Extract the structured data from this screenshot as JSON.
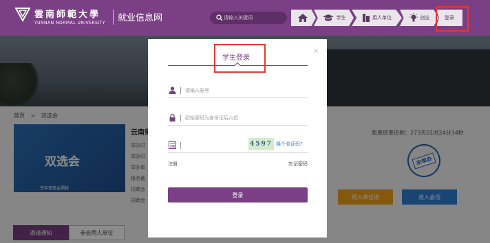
{
  "header": {
    "logo_cn": "雲南師範大學",
    "logo_en": "YUNNAN NORMAL UNIVERSITY",
    "site_title": "就业信息网",
    "search_placeholder": "请输入关键词"
  },
  "nav": {
    "student": "学生",
    "company": "用人单位",
    "startup": "创业",
    "login": "登录"
  },
  "page": {
    "breadcrumb": [
      "首页",
      ">",
      "双选会"
    ],
    "thumb_title": "双选会",
    "thumb_sub": "空中双选会揭秘",
    "event_title": "云南师",
    "event_rows": [
      "举办时",
      "举办时",
      "举办单",
      "报名截",
      "招聘会",
      "招聘会"
    ],
    "countdown": "距离结束还剩：273天01时24分34秒",
    "stamp": "未举办",
    "btn_company": "用人单位进",
    "btn_enter": "进入会场",
    "tabs": [
      "邀请通知",
      "参会用人单位"
    ]
  },
  "modal": {
    "title": "学生登录",
    "close": "×",
    "account_placeholder": "请输入账号",
    "password_placeholder": "初始密码为身份证后六位",
    "code_value": "",
    "captcha": "4597",
    "refresh_code": "换个验证码?",
    "register": "注册",
    "forgot": "忘记密码",
    "login_button": "登录"
  },
  "colors": {
    "brand_purple": "#7a3f84",
    "highlight_red": "#e53935",
    "link_blue": "#2e7fd6",
    "orange": "#f0a21a"
  },
  "icons": [
    "logo-mark-icon",
    "search-icon",
    "home-icon",
    "graduation-cap-icon",
    "building-icon",
    "lightbulb-icon",
    "user-icon",
    "lock-icon",
    "form-icon"
  ]
}
